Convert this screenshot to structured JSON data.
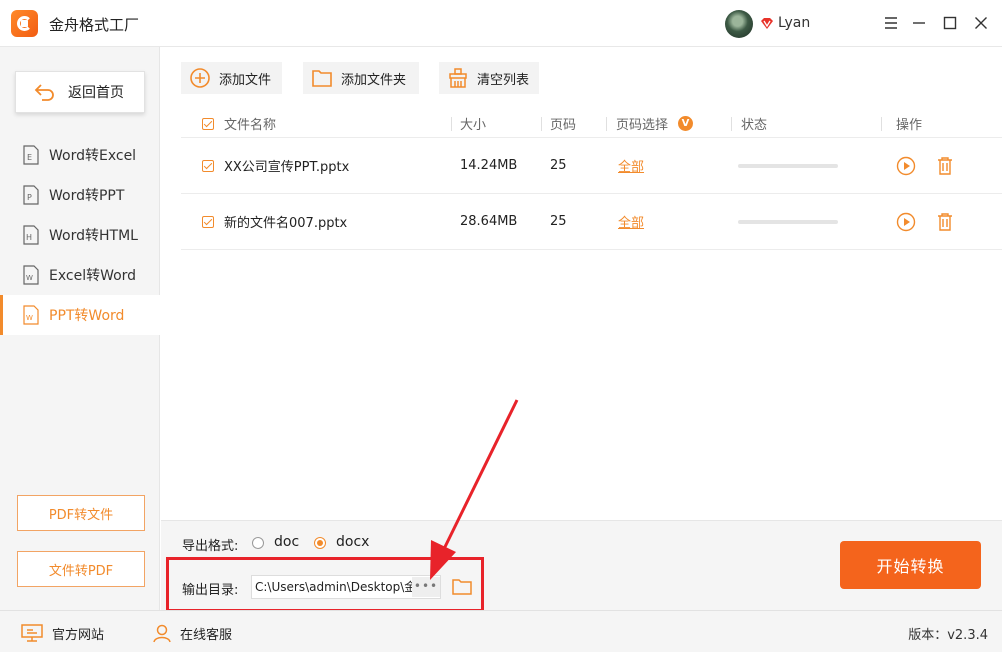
{
  "app": {
    "title": "金舟格式工厂",
    "username": "Lyan"
  },
  "sidebar": {
    "back_label": "返回首页",
    "items": [
      {
        "label": "Word转Excel",
        "active": false
      },
      {
        "label": "Word转PPT",
        "active": false
      },
      {
        "label": "Word转HTML",
        "active": false
      },
      {
        "label": "Excel转Word",
        "active": false
      },
      {
        "label": "PPT转Word",
        "active": true
      }
    ],
    "bottom_buttons": [
      "PDF转文件",
      "文件转PDF"
    ]
  },
  "toolbar": {
    "add_file": "添加文件",
    "add_folder": "添加文件夹",
    "clear_list": "清空列表"
  },
  "table": {
    "headers": {
      "name": "文件名称",
      "size": "大小",
      "pages": "页码",
      "page_select": "页码选择",
      "status": "状态",
      "actions": "操作"
    },
    "page_select_badge": "V",
    "rows": [
      {
        "name": "XX公司宣传PPT.pptx",
        "size": "14.24MB",
        "pages": "25",
        "page_select": "全部",
        "progress": 0
      },
      {
        "name": "新的文件名007.pptx",
        "size": "28.64MB",
        "pages": "25",
        "page_select": "全部",
        "progress": 0
      }
    ]
  },
  "export": {
    "format_label": "导出格式:",
    "formats": [
      {
        "label": "doc",
        "selected": false
      },
      {
        "label": "docx",
        "selected": true
      }
    ],
    "output_label": "输出目录:",
    "output_path": "C:\\Users\\admin\\Desktop\\金舟",
    "browse_label": "•••",
    "start_label": "开始转换"
  },
  "statusbar": {
    "website": "官方网站",
    "support": "在线客服",
    "version": "版本：v2.3.4"
  },
  "colors": {
    "accent": "#f28b2c",
    "start_button": "#f4641c",
    "highlight": "#e8232a"
  }
}
